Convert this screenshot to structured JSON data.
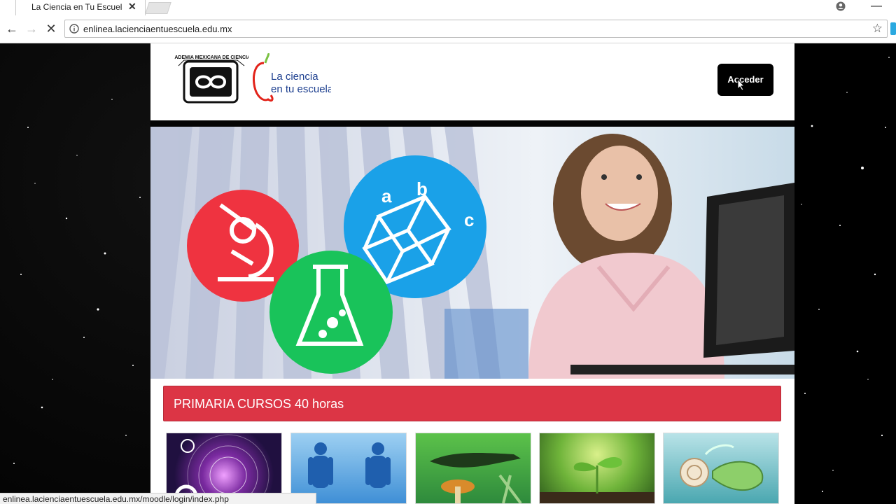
{
  "browser": {
    "tab_title": "La Ciencia en Tu Escuela",
    "tab_close": "✕",
    "url": "enlinea.lacienciaentuescuela.edu.mx",
    "status_url": "enlinea.lacienciaentuescuela.edu.mx/moodle/login/index.php",
    "icons": [
      "back-icon",
      "forward-icon",
      "reload-icon",
      "info-icon",
      "bookmark-star-icon",
      "profile-icon",
      "minimize-icon"
    ]
  },
  "header": {
    "logo_amc_alt": "ACADEMIA MEXICANA DE CIENCIAS",
    "logo_cte_line1": "La ciencia",
    "logo_cte_line2": "en tu escuela",
    "login_label": "Acceder"
  },
  "banner": {
    "letters": [
      "a",
      "b",
      "c"
    ]
  },
  "section": {
    "title": "PRIMARIA CURSOS 40 horas"
  },
  "courses": [
    {
      "theme": "physics-energy"
    },
    {
      "theme": "human-body"
    },
    {
      "theme": "animals-fossils"
    },
    {
      "theme": "plants-seedling"
    },
    {
      "theme": "snail-nature"
    }
  ],
  "colors": {
    "section_red": "#dc3545",
    "circle_red": "#ef3340",
    "circle_blue": "#1aa1e8",
    "circle_green": "#19c35a"
  }
}
